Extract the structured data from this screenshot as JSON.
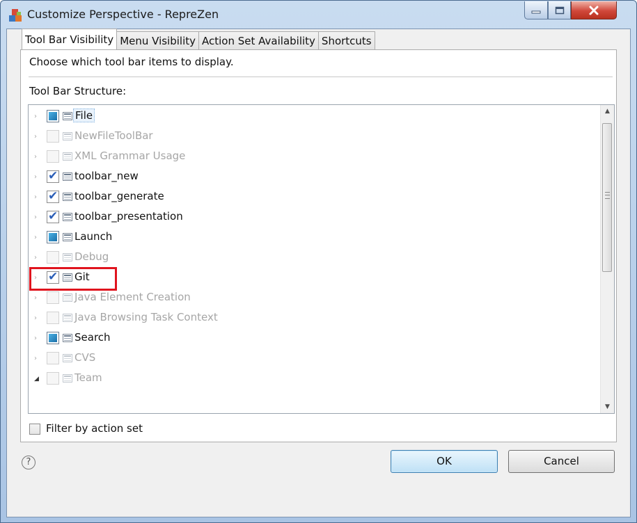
{
  "window": {
    "title": "Customize Perspective - RepreZen"
  },
  "tabs": [
    {
      "label": "Tool Bar Visibility",
      "active": true
    },
    {
      "label": "Menu Visibility",
      "active": false
    },
    {
      "label": "Action Set Availability",
      "active": false
    },
    {
      "label": "Shortcuts",
      "active": false
    }
  ],
  "panel": {
    "description": "Choose which tool bar items to display.",
    "structure_label": "Tool Bar Structure:"
  },
  "tree_items": [
    {
      "label": "File",
      "state": "partial",
      "enabled": true,
      "selected": true
    },
    {
      "label": "NewFileToolBar",
      "state": "unchecked",
      "enabled": false
    },
    {
      "label": "XML Grammar Usage",
      "state": "unchecked",
      "enabled": false
    },
    {
      "label": "toolbar_new",
      "state": "checked",
      "enabled": true
    },
    {
      "label": "toolbar_generate",
      "state": "checked",
      "enabled": true
    },
    {
      "label": "toolbar_presentation",
      "state": "checked",
      "enabled": true
    },
    {
      "label": "Launch",
      "state": "partial",
      "enabled": true
    },
    {
      "label": "Debug",
      "state": "unchecked",
      "enabled": false
    },
    {
      "label": "Git",
      "state": "checked",
      "enabled": true,
      "highlighted": true
    },
    {
      "label": "Java Element Creation",
      "state": "unchecked",
      "enabled": false
    },
    {
      "label": "Java Browsing Task Context",
      "state": "unchecked",
      "enabled": false
    },
    {
      "label": "Search",
      "state": "partial",
      "enabled": true
    },
    {
      "label": "CVS",
      "state": "unchecked",
      "enabled": false
    },
    {
      "label": "Team",
      "state": "unchecked",
      "enabled": false,
      "expanded": true
    }
  ],
  "filter": {
    "label": "Filter by action set",
    "checked": false
  },
  "buttons": {
    "ok": "OK",
    "cancel": "Cancel"
  },
  "icons": {
    "help": "help-icon",
    "minimize": "minimize-icon",
    "maximize": "maximize-icon",
    "close": "close-icon"
  },
  "colors": {
    "highlight_box": "#e0141e",
    "checkmark": "#2c5fb7"
  }
}
